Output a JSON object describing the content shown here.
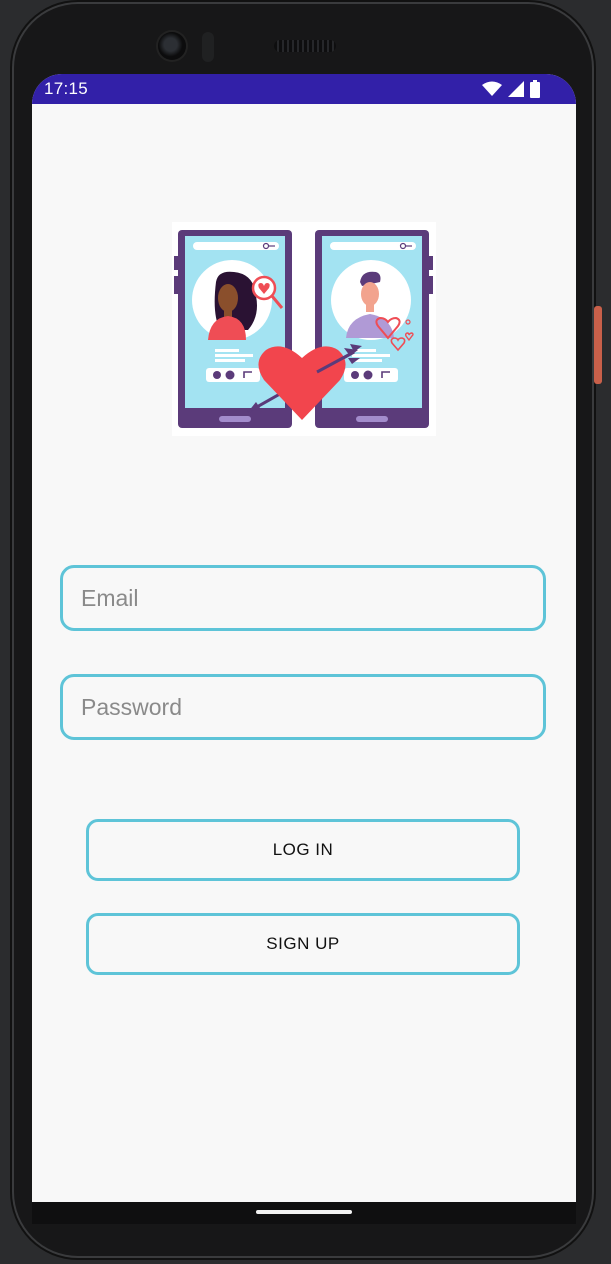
{
  "status_bar": {
    "time": "17:15",
    "icons": [
      "wifi-icon",
      "signal-icon",
      "battery-icon"
    ],
    "background": "#3220a8"
  },
  "illustration": {
    "name": "dating-app-illustration"
  },
  "form": {
    "email_placeholder": "Email",
    "email_value": "",
    "password_placeholder": "Password",
    "password_value": ""
  },
  "buttons": {
    "login_label": "LOG IN",
    "signup_label": "SIGN UP"
  },
  "colors": {
    "accent_border": "#5ec4d8",
    "screen_background": "#f8f8f8"
  }
}
